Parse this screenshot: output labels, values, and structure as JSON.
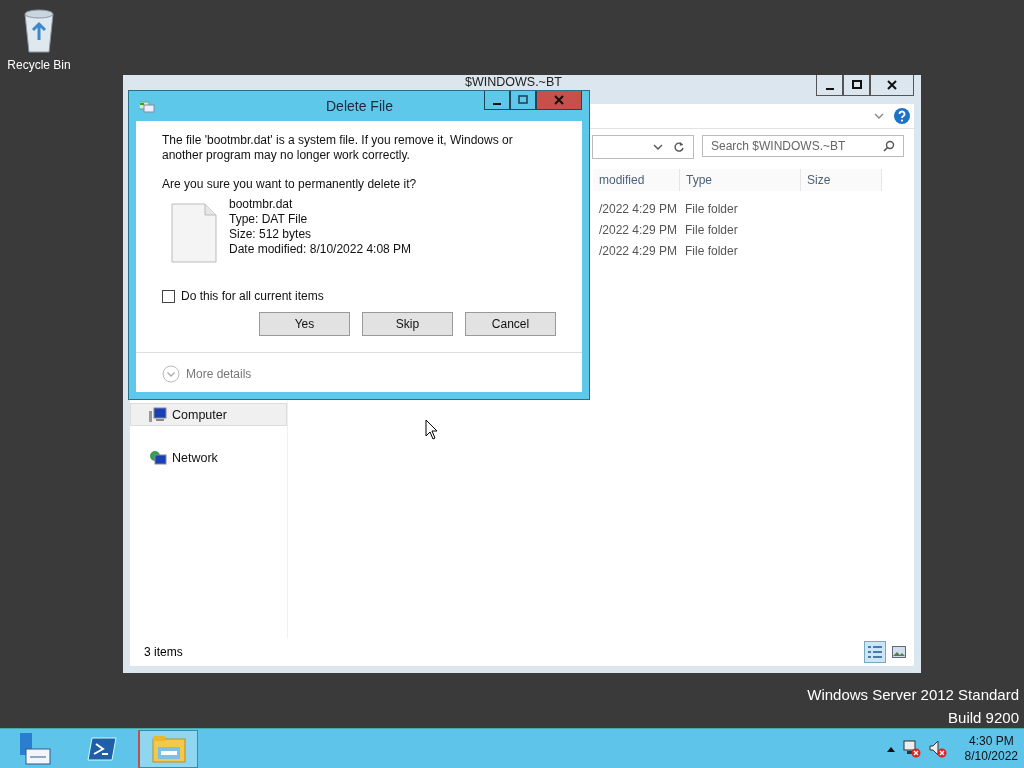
{
  "desktop": {
    "icons": [
      {
        "label": "Recycle Bin"
      }
    ],
    "watermark": [
      "Windows Server 2012 Standard",
      "Build 9200"
    ]
  },
  "explorer": {
    "title": "$WINDOWS.~BT",
    "search": {
      "placeholder": "Search $WINDOWS.~BT"
    },
    "columns": [
      "modified",
      "Type",
      "Size"
    ],
    "rows": [
      {
        "modified": "/2022 4:29 PM",
        "type": "File folder"
      },
      {
        "modified": "/2022 4:29 PM",
        "type": "File folder"
      },
      {
        "modified": "/2022 4:29 PM",
        "type": "File folder"
      }
    ],
    "nav": [
      {
        "kind": "computer",
        "label": "Computer",
        "selected": true
      },
      {
        "kind": "network",
        "label": "Network",
        "selected": false
      }
    ],
    "status": "3 items",
    "views": [
      {
        "kind": "details",
        "selected": true
      },
      {
        "kind": "tiles",
        "selected": false
      }
    ]
  },
  "dialog": {
    "title": "Delete File",
    "message": "The file 'bootmbr.dat' is a system file. If you remove it, Windows or another program may no longer work correctly.",
    "question": "Are you sure you want to permanently delete it?",
    "file": {
      "name": "bootmbr.dat",
      "details": [
        "Type: DAT File",
        "Size: 512 bytes",
        "Date modified: 8/10/2022 4:08 PM"
      ]
    },
    "checkbox": {
      "label": "Do this for all current items",
      "checked": false
    },
    "buttons": [
      "Yes",
      "Skip",
      "Cancel"
    ],
    "more_details": "More details"
  },
  "taskbar": {
    "apps": [
      {
        "kind": "server-manager",
        "selected": false
      },
      {
        "kind": "powershell",
        "selected": false
      },
      {
        "kind": "explorer",
        "selected": true
      }
    ],
    "clock": {
      "time": "4:30 PM",
      "date": "8/10/2022"
    }
  }
}
